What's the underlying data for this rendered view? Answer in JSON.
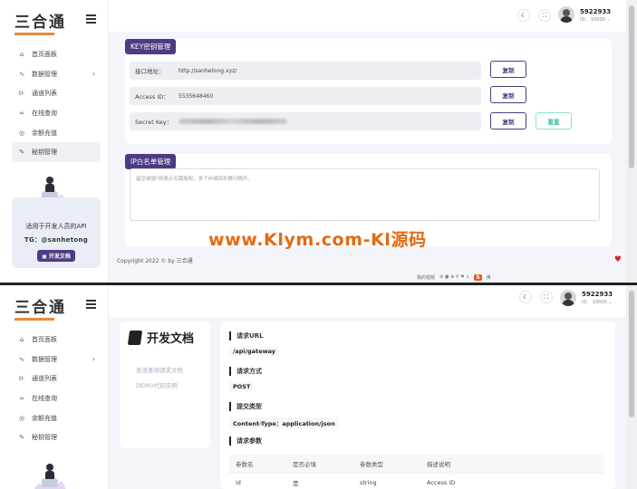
{
  "brand": {
    "logo_text": "三合通",
    "accent": "#4d3b83",
    "logo_color": "#f0883a"
  },
  "user": {
    "name": "5922933",
    "id_label": "ID： 10000 ⌄"
  },
  "sidebar": {
    "items": [
      {
        "label": "首页面板",
        "icon": "home-icon"
      },
      {
        "label": "数据管理",
        "icon": "activity-icon",
        "has_sub": true
      },
      {
        "label": "通道列表",
        "icon": "channel-icon"
      },
      {
        "label": "在线查询",
        "icon": "link-icon"
      },
      {
        "label": "余额充值",
        "icon": "target-icon"
      },
      {
        "label": "秘钥管理",
        "icon": "key-icon"
      }
    ],
    "promo": {
      "line1": "适用于开发人员的API",
      "line2": "TG：@sanhetong",
      "button": "开发文档"
    }
  },
  "key_card": {
    "title": "KEY密钥管理",
    "rows": [
      {
        "label": "接口地址：",
        "value": "http://sanhetong.xyz/"
      },
      {
        "label": "Access ID：",
        "value": "5535648460"
      },
      {
        "label": "Secret Key：",
        "value": ""
      }
    ],
    "copy": "复制",
    "reset": "重置"
  },
  "ip_card": {
    "title": "IP白名单管理",
    "placeholder": "留空或填*则表示无需授权。多个IP请回车换行隔开。"
  },
  "footer": {
    "copyright": "Copyright 2022 © by 三合通"
  },
  "watermark": "www.Klym.com-Kl源码",
  "tray": {
    "items": [
      "我的视频",
      "英"
    ],
    "s": "S"
  },
  "docs": {
    "title": "开发文档",
    "links": [
      "发送查询请求文档",
      "DEMO代码实例"
    ]
  },
  "api": {
    "sections": [
      {
        "heading": "请求URL",
        "value": "/api/gateway"
      },
      {
        "heading": "请求方式",
        "value": "POST"
      },
      {
        "heading": "提交类型",
        "value": "Content-Type：application/json"
      },
      {
        "heading": "请求参数",
        "value": ""
      }
    ],
    "table": {
      "headers": [
        "参数名",
        "是否必填",
        "参数类型",
        "描述说明"
      ],
      "rows": [
        [
          "id",
          "是",
          "string",
          "Access ID"
        ]
      ]
    }
  }
}
